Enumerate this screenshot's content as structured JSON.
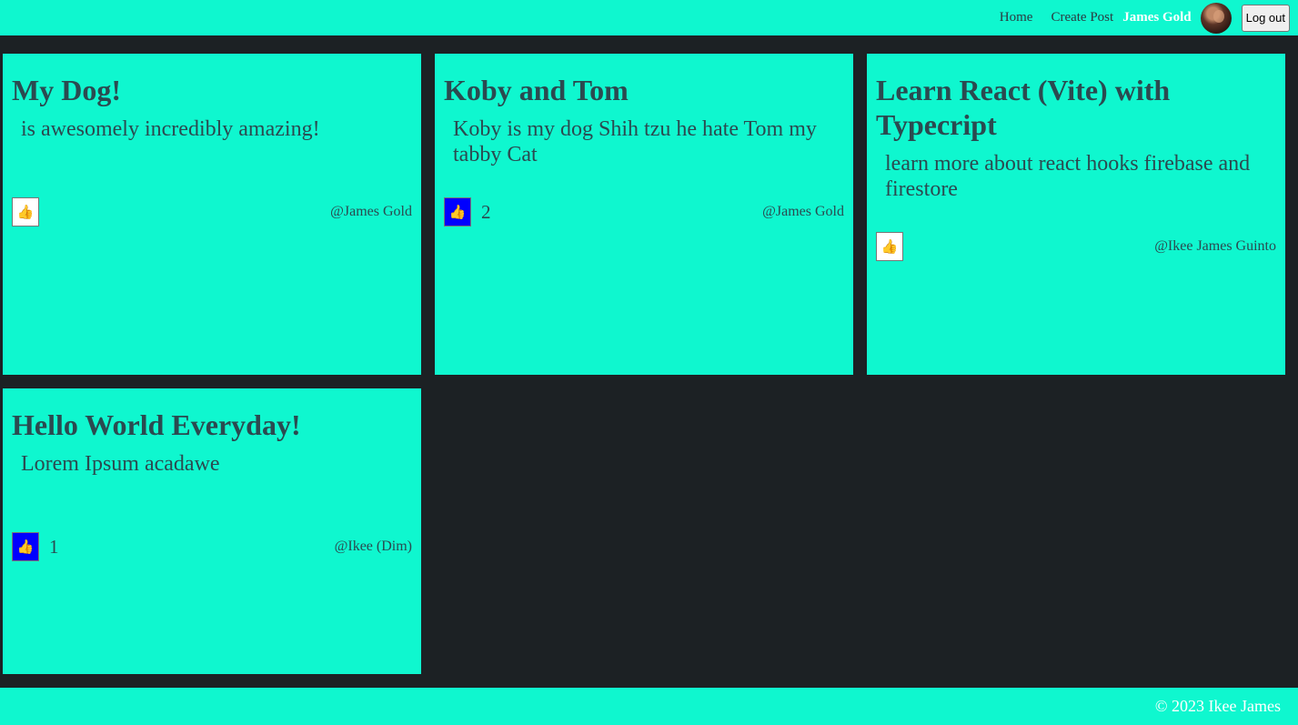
{
  "nav": {
    "home_label": "Home",
    "create_label": "Create Post",
    "user_name": "James Gold",
    "logout_label": "Log out"
  },
  "posts": [
    {
      "title": "My Dog!",
      "body": "is awesomely incredibly amazing!",
      "liked": false,
      "likes": "",
      "author": "@James Gold"
    },
    {
      "title": "Koby and Tom",
      "body": "Koby is my dog Shih tzu he hate Tom my tabby Cat",
      "liked": true,
      "likes": "2",
      "author": "@James Gold"
    },
    {
      "title": "Learn React (Vite) with Typecript",
      "body": "learn more about react hooks firebase and firestore",
      "liked": false,
      "likes": "",
      "author": "@Ikee James Guinto"
    },
    {
      "title": "Hello World Everyday!",
      "body": "Lorem Ipsum acadawe",
      "liked": true,
      "likes": "1",
      "author": "@Ikee (Dim)"
    }
  ],
  "like_icon": "thumbs-up-icon",
  "footer": {
    "copyright": "© 2023 Ikee James"
  },
  "colors": {
    "accent": "#0ff7cf",
    "background": "#1c2124",
    "liked": "#0000ff"
  }
}
